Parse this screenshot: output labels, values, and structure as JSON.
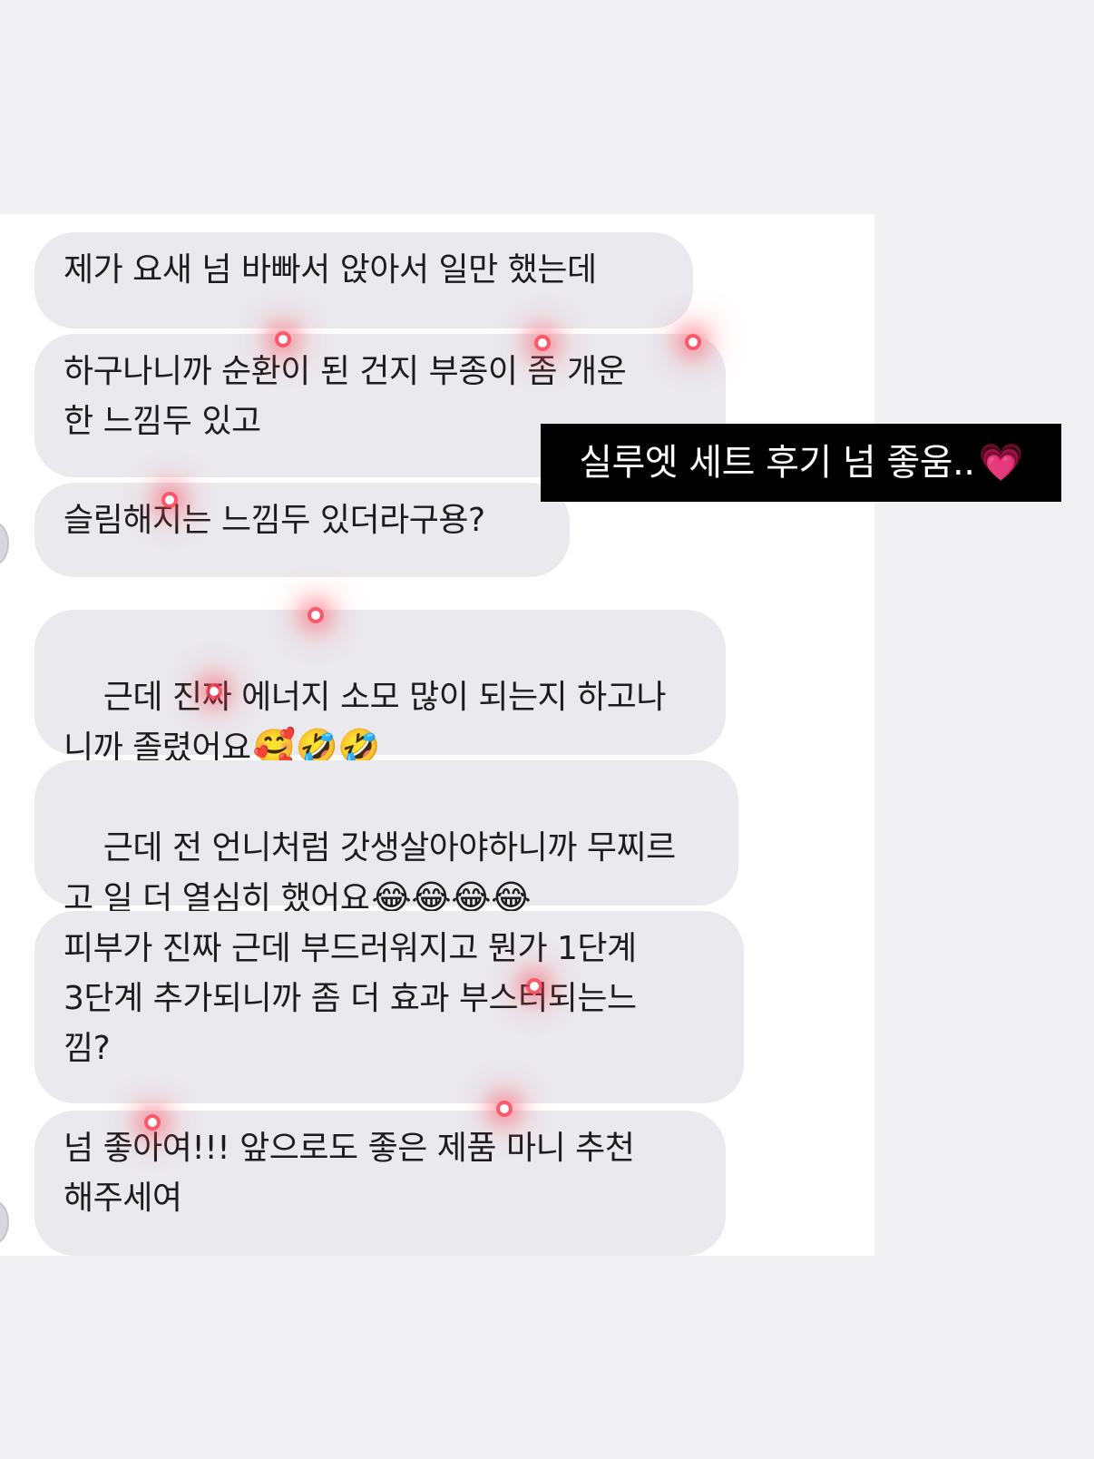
{
  "messages": [
    {
      "text": "제가 요새 넘 바빠서 앉아서 일만 했는데",
      "emoji": ""
    },
    {
      "text": "하구나니까 순환이 된 건지 부종이 좀 개운\n한 느낌두 있고",
      "emoji": ""
    },
    {
      "text": "슬림해지는 느낌두 있더라구용?",
      "emoji": ""
    },
    {
      "text": "근데 진짜 에너지 소모 많이 되는지 하고나\n니까 졸렸어요",
      "emoji": "🥰🤣🤣"
    },
    {
      "text": "근데 전 언니처럼 갓생살아야하니까 무찌르\n고 일 더 열심히 했어요",
      "emoji": "😂😂😂😂"
    },
    {
      "text": "피부가 진짜 근데 부드러워지고 뭔가 1단계\n3단계 추가되니까 좀 더 효과 부스터되는느\n낌?",
      "emoji": ""
    },
    {
      "text": "넘 좋아여!!! 앞으로도 좋은 제품 마니 추천\n해주세여",
      "emoji": ""
    }
  ],
  "caption": {
    "text": "실루엣 세트 후기 넘 좋움..",
    "heart": "💗"
  },
  "colors": {
    "bubble": "#eaeaee",
    "caption_bg": "#000000",
    "page_bg": "#f1f1f4"
  }
}
